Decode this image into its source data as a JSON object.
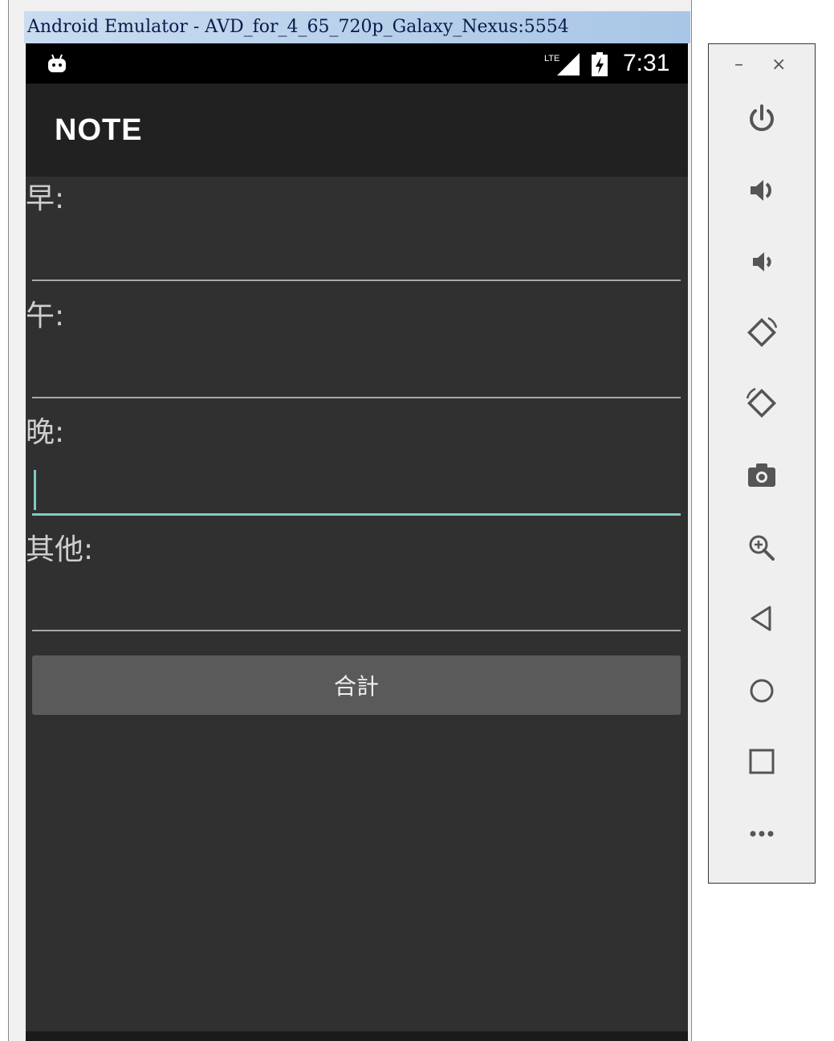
{
  "window": {
    "title": "Android Emulator - AVD_for_4_65_720p_Galaxy_Nexus:5554"
  },
  "status_bar": {
    "time": "7:31",
    "network_label": "LTE",
    "icons": [
      "android-debug-icon",
      "lte-signal-icon",
      "battery-icon"
    ]
  },
  "app_bar": {
    "title": "NOTE"
  },
  "form": {
    "fields": [
      {
        "label": "早:",
        "value": ""
      },
      {
        "label": "午:",
        "value": ""
      },
      {
        "label": "晚:",
        "value": ""
      },
      {
        "label": "其他:",
        "value": ""
      }
    ],
    "focused_field": "晚:",
    "accent_color": "#80cbc4",
    "submit_label": "合計"
  },
  "toolbar": {
    "minimize_label": "–",
    "close_label": "×",
    "buttons": [
      {
        "name": "power-icon"
      },
      {
        "name": "volume-up-icon"
      },
      {
        "name": "volume-down-icon"
      },
      {
        "name": "rotate-left-icon"
      },
      {
        "name": "rotate-right-icon"
      },
      {
        "name": "camera-icon"
      },
      {
        "name": "zoom-icon"
      },
      {
        "name": "back-icon"
      },
      {
        "name": "home-icon"
      },
      {
        "name": "overview-icon"
      },
      {
        "name": "more-icon"
      }
    ]
  }
}
